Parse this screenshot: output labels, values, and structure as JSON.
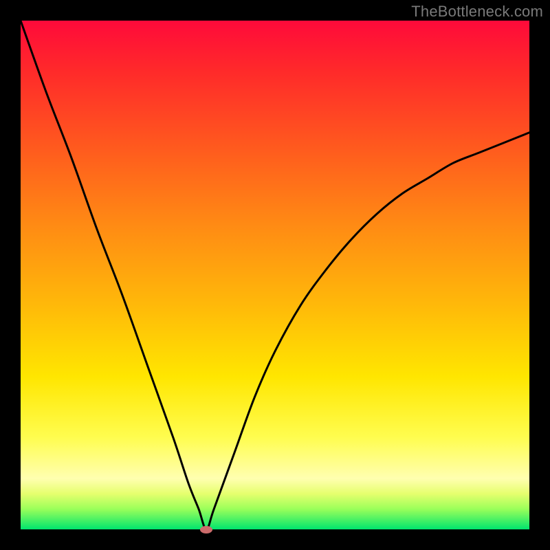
{
  "attribution": "TheBottleneck.com",
  "chart_data": {
    "type": "line",
    "title": "",
    "xlabel": "",
    "ylabel": "",
    "xlim": [
      0,
      100
    ],
    "ylim": [
      0,
      100
    ],
    "series": [
      {
        "name": "bottleneck-curve",
        "x": [
          0,
          5,
          10,
          15,
          20,
          25,
          30,
          33,
          35,
          36.5,
          38,
          42,
          46,
          50,
          55,
          60,
          65,
          70,
          75,
          80,
          85,
          90,
          95,
          100
        ],
        "values": [
          100,
          86,
          73,
          59,
          46,
          32,
          18,
          9,
          4,
          0,
          4,
          15,
          26,
          35,
          44,
          51,
          57,
          62,
          66,
          69,
          72,
          74,
          76,
          78
        ]
      }
    ],
    "marker": {
      "x": 36.5,
      "y": 0,
      "color": "#cc6b6b"
    },
    "background_gradient": {
      "top": "#ff0a3a",
      "mid": "#ffe600",
      "bottom": "#00e46e"
    }
  }
}
